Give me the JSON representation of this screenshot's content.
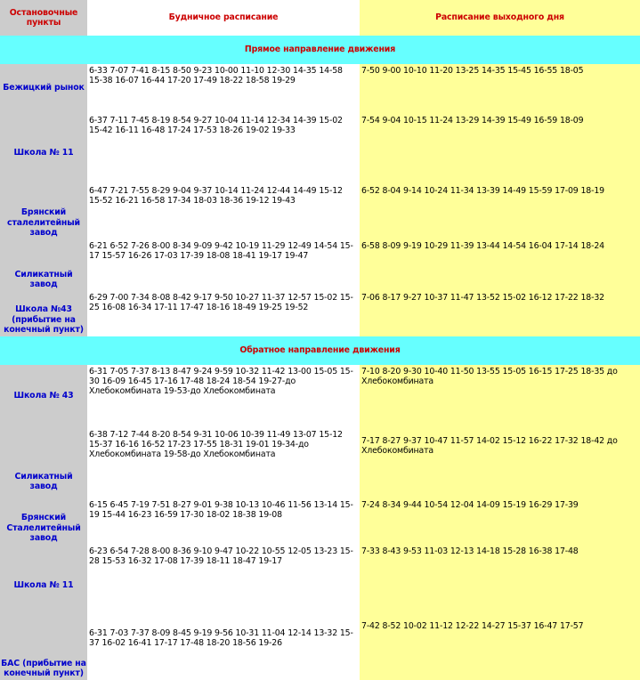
{
  "headers": {
    "stops": "Остановочные пункты",
    "weekday": "Будничное расписание",
    "weekend": "Расписание выходного дня"
  },
  "sections": [
    {
      "title": "Прямое направление движения",
      "rows": [
        {
          "stop": "Бежицкий рынок",
          "weekday": "6-33 7-07 7-41 8-15 8-50 9-23 10-00 11-10 12-30 14-35 14-58 15-38 16-07 16-44 17-20 17-49 18-22 18-58 19-29",
          "weekend": "7-50 9-00 10-10 11-20 13-25 14-35 15-45 16-55 18-05"
        },
        {
          "stop": "Школа № 11",
          "weekday": "6-37 7-11 7-45 8-19 8-54 9-27 10-04 11-14 12-34 14-39 15-02 15-42 16-11 16-48 17-24 17-53 18-26 19-02 19-33",
          "weekend": "7-54 9-04 10-15 11-24 13-29 14-39 15-49 16-59 18-09"
        },
        {
          "stop": "Брянский сталелитейный завод",
          "weekday": "6-47 7-21 7-55 8-29 9-04 9-37 10-14 11-24 12-44 14-49 15-12 15-52 16-21 16-58 17-34 18-03 18-36 19-12 19-43",
          "weekend": "6-52 8-04 9-14 10-24 11-34 13-39 14-49 15-59 17-09 18-19"
        },
        {
          "stop": "Силикатный завод",
          "weekday": "6-21 6-52 7-26 8-00 8-34 9-09 9-42 10-19 11-29 12-49 14-54 15-17 15-57 16-26 17-03 17-39 18-08 18-41 19-17 19-47",
          "weekend": "6-58 8-09 9-19 10-29 11-39 13-44 14-54 16-04 17-14 18-24"
        },
        {
          "stop": "Школа №43 (прибытие на конечный пункт)",
          "weekday": "6-29 7-00 7-34 8-08 8-42 9-17 9-50 10-27 11-37 12-57 15-02 15-25 16-08 16-34 17-11 17-47 18-16 18-49 19-25 19-52",
          "weekend": "7-06 8-17 9-27 10-37 11-47 13-52 15-02 16-12 17-22 18-32"
        }
      ]
    },
    {
      "title": "Обратное направление движения",
      "rows": [
        {
          "stop": "Школа № 43",
          "weekday": "6-31 7-05 7-37 8-13 8-47 9-24 9-59 10-32 11-42 13-00 15-05 15-30 16-09 16-45 17-16 17-48 18-24 18-54 19-27-до Хлебокомбината 19-53-до Хлебокомбината",
          "weekend": "7-10 8-20 9-30 10-40 11-50 13-55 15-05 16-15 17-25 18-35 до Хлебокомбината"
        },
        {
          "stop": "Силикатный завод",
          "weekday": "6-38 7-12 7-44 8-20 8-54 9-31 10-06 10-39 11-49 13-07 15-12 15-37 16-16 16-52 17-23 17-55 18-31 19-01 19-34-до Хлебокомбината 19-58-до Хлебокомбината",
          "weekend": "7-17 8-27 9-37 10-47 11-57 14-02 15-12 16-22 17-32 18-42 до Хлебокомбината"
        },
        {
          "stop": "Брянский Сталелитейный завод",
          "weekday": "6-15 6-45 7-19 7-51 8-27 9-01 9-38 10-13 10-46 11-56 13-14 15-19 15-44 16-23 16-59 17-30 18-02 18-38 19-08",
          "weekend": "7-24 8-34 9-44 10-54 12-04 14-09 15-19 16-29 17-39"
        },
        {
          "stop": "Школа № 11",
          "weekday": "6-23 6-54 7-28 8-00 8-36 9-10 9-47 10-22 10-55 12-05 13-23 15-28 15-53 16-32 17-08 17-39 18-11 18-47 19-17",
          "weekend": "7-33 8-43 9-53 11-03 12-13 14-18 15-28 16-38 17-48"
        },
        {
          "stop": "БАС (прибытие на конечный пункт)",
          "weekday": "6-31 7-03 7-37 8-09 8-45 9-19 9-56 10-31 11-04 12-14 13-32 15-37 16-02 16-41 17-17 17-48 18-20 18-56 19-26",
          "weekend": "7-42 8-52 10-02 11-12 12-22 14-27 15-37 16-47 17-57"
        }
      ]
    }
  ]
}
